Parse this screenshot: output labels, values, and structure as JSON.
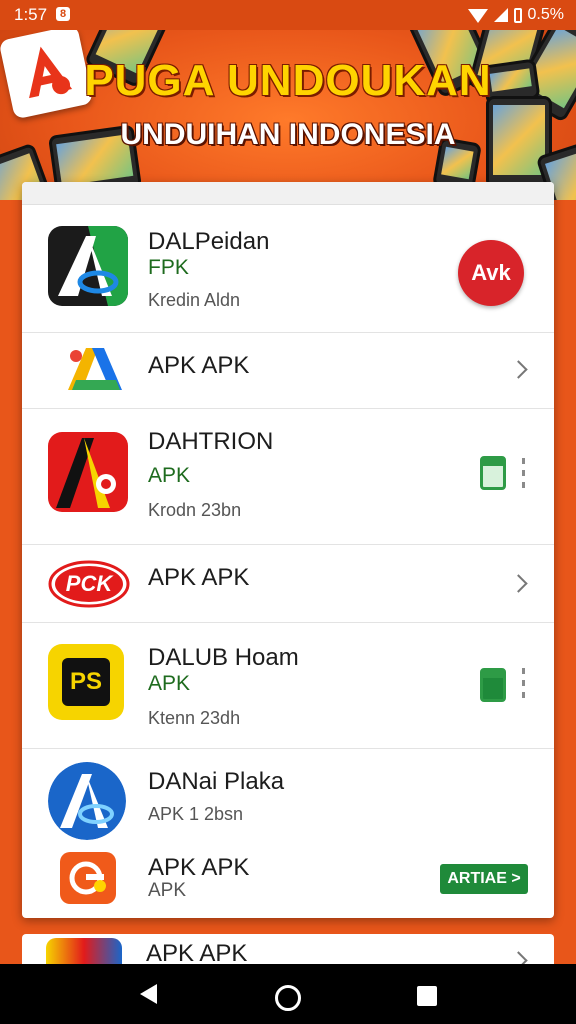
{
  "status_bar": {
    "time": "1:57",
    "notification": "8",
    "battery": "0.5%"
  },
  "hero": {
    "title": "PUGA UNDOUKAN",
    "subtitle": "UNDUIHAN INDONESIA"
  },
  "apps": [
    {
      "title": "DALPeidan",
      "subtitle": "FPK",
      "meta": "Kredin Aldn",
      "badge": "Avk"
    },
    {
      "title": "APK APK"
    },
    {
      "title": "DAHTRION",
      "subtitle": "APK",
      "meta": "Krodn 23bn"
    },
    {
      "title": "APK APK",
      "icon_text": "PCK"
    },
    {
      "title": "DALUB Hoam",
      "subtitle": "APK",
      "meta": "Ktenn 23dh",
      "icon_text": "PS"
    },
    {
      "title": "DANai Plaka",
      "meta": "APK 1 2bsn"
    },
    {
      "title": "APK APK",
      "subtitle": "APK",
      "action": "ARTIAE >"
    },
    {
      "title": "APK APK"
    }
  ],
  "colors": {
    "accent": "#e8561a",
    "green": "#1f8a3a",
    "red": "#d8242a"
  }
}
